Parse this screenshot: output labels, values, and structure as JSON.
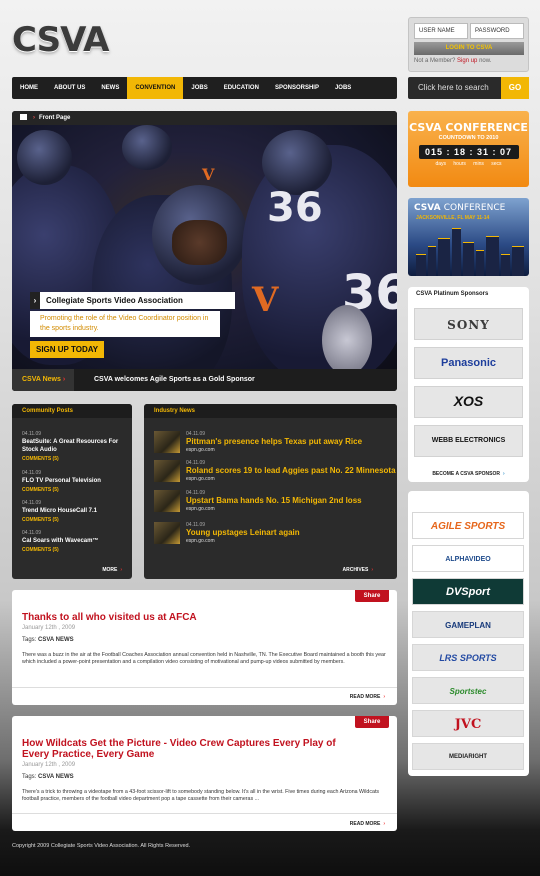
{
  "header": {
    "logo": "CSVA"
  },
  "login": {
    "username_placeholder": "USER NAME",
    "password_placeholder": "PASSWORD",
    "button": "LOGIN TO CSVA",
    "not_member": "Not a Member?",
    "signup": "Sign up",
    "now": "now."
  },
  "nav": {
    "items": [
      "HOME",
      "ABOUT US",
      "NEWS",
      "CONVENTION",
      "JOBS",
      "EDUCATION",
      "SPONSORSHIP",
      "JOBS"
    ],
    "active": "CONVENTION"
  },
  "search": {
    "placeholder": "Click here to search",
    "button": "GO"
  },
  "hero": {
    "breadcrumb": "Front Page",
    "title": "Collegiate Sports Video Association",
    "subtitle": "Promoting the role of the Video Coordinator position in the sports industry.",
    "cta": "SIGN UP TODAY",
    "news_label": "CSVA News",
    "news_text": "CSVA welcomes Agile Sports as a Gold Sponsor"
  },
  "community": {
    "title": "Community Posts",
    "more": "MORE",
    "posts": [
      {
        "date": "04.11.09",
        "title": "BeatSuite: A Great Resources For Stock Audio",
        "comments": "COMMENTS (5)"
      },
      {
        "date": "04.11.09",
        "title": "FLO TV Personal Television",
        "comments": "COMMENTS (5)"
      },
      {
        "date": "04.11.09",
        "title": "Trend Micro HouseCall 7.1",
        "comments": "COMMENTS (5)"
      },
      {
        "date": "04.11.09",
        "title": "Cal Soars with Wavecam™",
        "comments": "COMMENTS (5)"
      }
    ]
  },
  "industry": {
    "title": "Industry News",
    "archives": "ARCHIVES",
    "items": [
      {
        "date": "04.11.09",
        "title": "Pittman's presence helps Texas put away Rice",
        "source": "espn.go.com"
      },
      {
        "date": "04.11.09",
        "title": "Roland scores 19 to lead Aggies past No. 22 Minnesota",
        "source": "espn.go.com"
      },
      {
        "date": "04.11.09",
        "title": "Upstart Bama hands No. 15 Michigan 2nd loss",
        "source": "espn.go.com"
      },
      {
        "date": "04.11.09",
        "title": "Young upstages Leinart again",
        "source": "espn.go.com"
      }
    ]
  },
  "articles": [
    {
      "share": "Share",
      "title": "Thanks to all who visited us at AFCA",
      "date": "January 12th , 2009",
      "tags": "Tags:",
      "tag": "CSVA NEWS",
      "body": "There was a buzz in the air at the Football Coaches Association annual convention held in Nashville, TN.   The Executive Board maintained a booth this year which included a power-point presentation and a compilation video consisting of motivational and pump-up videos submitted by members.",
      "read_more": "READ MORE"
    },
    {
      "share": "Share",
      "title": "How Wildcats Get the Picture - Video Crew Captures Every Play of Every Practice, Every Game",
      "date": "January 12th , 2009",
      "tags": "Tags:",
      "tag": "CSVA NEWS",
      "body": "There's a trick to throwing a videotape from a 43-foot scissor-lift to somebody standing below. It's all in the wrist. Five times during each Arizona Wildcats football practice, members of the football video department pop a tape cassette from their cameras ...",
      "read_more": "READ MORE"
    }
  ],
  "countdown": {
    "title": "CSVA CONFERENCE",
    "subtitle": "COUNTDOWN TO 2010",
    "time": "015 : 18 : 31 : 07",
    "units": "days hours mins secs"
  },
  "conference": {
    "title_bold": "CSVA",
    "title_rest": "CONFERENCE",
    "location": "JACKSONVILLE, FL  MAY 11-14"
  },
  "platinum": {
    "title": "CSVA Platinum Sponsors",
    "sponsors": [
      "SONY",
      "Panasonic",
      "XOS",
      "WEBB ELECTRONICS"
    ],
    "become": "BECOME A CSVA SPONSOR"
  },
  "sponsors": {
    "logos": [
      "AGILE SPORTS",
      "ALPHAVIDEO",
      "DVSport",
      "GAMEPLAN",
      "LRS SPORTS",
      "Sportstec",
      "JVC",
      "MEDIARIGHT"
    ]
  },
  "footer": {
    "copyright": "Copyright 2009 Collegiate Sports Video Association. All Rights Reserved."
  },
  "colors": {
    "accent": "#f2b705",
    "red": "#c1121f",
    "nav_bg": "#1f1f1f",
    "orange": "#f28a12"
  }
}
